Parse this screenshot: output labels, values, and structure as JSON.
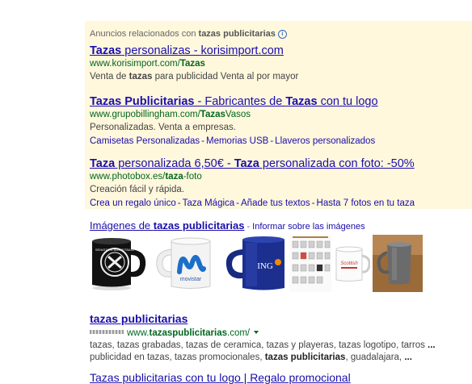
{
  "ads_header": {
    "prefix": "Anuncios relacionados con ",
    "query": "tazas publicitarias"
  },
  "ads": [
    {
      "title_parts": [
        {
          "text": "Tazas",
          "bold": true
        },
        {
          "text": " personalizas - korisimport.com",
          "bold": false
        }
      ],
      "url_parts": [
        {
          "text": "www.korisimport.com/",
          "bold": false
        },
        {
          "text": "Tazas",
          "bold": true
        }
      ],
      "desc_parts": [
        {
          "text": "Venta de ",
          "bold": false
        },
        {
          "text": "tazas",
          "bold": true
        },
        {
          "text": " para publicidad Venta al por mayor",
          "bold": false
        }
      ],
      "sitelinks": []
    },
    {
      "title_parts": [
        {
          "text": "Tazas Publicitarias",
          "bold": true
        },
        {
          "text": " - Fabricantes de ",
          "bold": false
        },
        {
          "text": "Tazas",
          "bold": true
        },
        {
          "text": " con tu logo",
          "bold": false
        }
      ],
      "url_parts": [
        {
          "text": "www.grupobillingham.com/",
          "bold": false
        },
        {
          "text": "Tazas",
          "bold": true
        },
        {
          "text": "Vasos",
          "bold": false
        }
      ],
      "desc_parts": [
        {
          "text": "Personalizadas. Venta a empresas.",
          "bold": false
        }
      ],
      "sitelinks": [
        "Camisetas Personalizadas",
        "Memorias USB",
        "Llaveros personalizados"
      ]
    },
    {
      "title_parts": [
        {
          "text": "Taza",
          "bold": true
        },
        {
          "text": " personalizada 6,50€ - ",
          "bold": false
        },
        {
          "text": "Taza",
          "bold": true
        },
        {
          "text": " personalizada con foto: -50%",
          "bold": false
        }
      ],
      "url_parts": [
        {
          "text": "www.photobox.es/",
          "bold": false
        },
        {
          "text": "taza",
          "bold": true
        },
        {
          "text": "-foto",
          "bold": false
        }
      ],
      "desc_parts": [
        {
          "text": "Creación fácil y rápida.",
          "bold": false
        }
      ],
      "sitelinks": [
        "Crea un regalo único",
        "Taza Mágica",
        "Añade tus textos",
        "Hasta 7 fotos en tu taza"
      ]
    }
  ],
  "images": {
    "title_prefix": "Imágenes de ",
    "title_query": "tazas publicitarias",
    "report_label": "Informar sobre las imágenes",
    "thumbs": [
      {
        "icon": "black-mug-image",
        "text": "SENATORS BASKETBALL"
      },
      {
        "icon": "movistar-mug-image",
        "text": "movistar"
      },
      {
        "icon": "blue-mug-image",
        "text": "ING"
      },
      {
        "icon": "mug-catalog-image",
        "text": ""
      },
      {
        "icon": "scottish-mug-image",
        "text": "Scottish"
      },
      {
        "icon": "photo-mug-image",
        "text": ""
      }
    ]
  },
  "organic": {
    "title": "tazas publicitarias",
    "url_prefix": "www.",
    "url_bold": "tazaspublicitarias",
    "url_suffix": ".com/",
    "snippet_lines": [
      [
        {
          "text": "tazas, tazas grabadas, tazas de ceramica, tazas y playeras, tazas logotipo, tarros ",
          "bold": false
        },
        {
          "text": "...",
          "bold": true
        }
      ],
      [
        {
          "text": "publicidad en tazas, tazas promocionales, ",
          "bold": false
        },
        {
          "text": "tazas publicitarias",
          "bold": true
        },
        {
          "text": ", guadalajara, ",
          "bold": false
        },
        {
          "text": "...",
          "bold": true
        }
      ]
    ]
  },
  "cutoff_text": "Tazas publicitarias con tu logo | Regalo promocional",
  "colors": {
    "link": "#1a0dab",
    "url": "#006621",
    "ad_background": "#fff8dd"
  }
}
